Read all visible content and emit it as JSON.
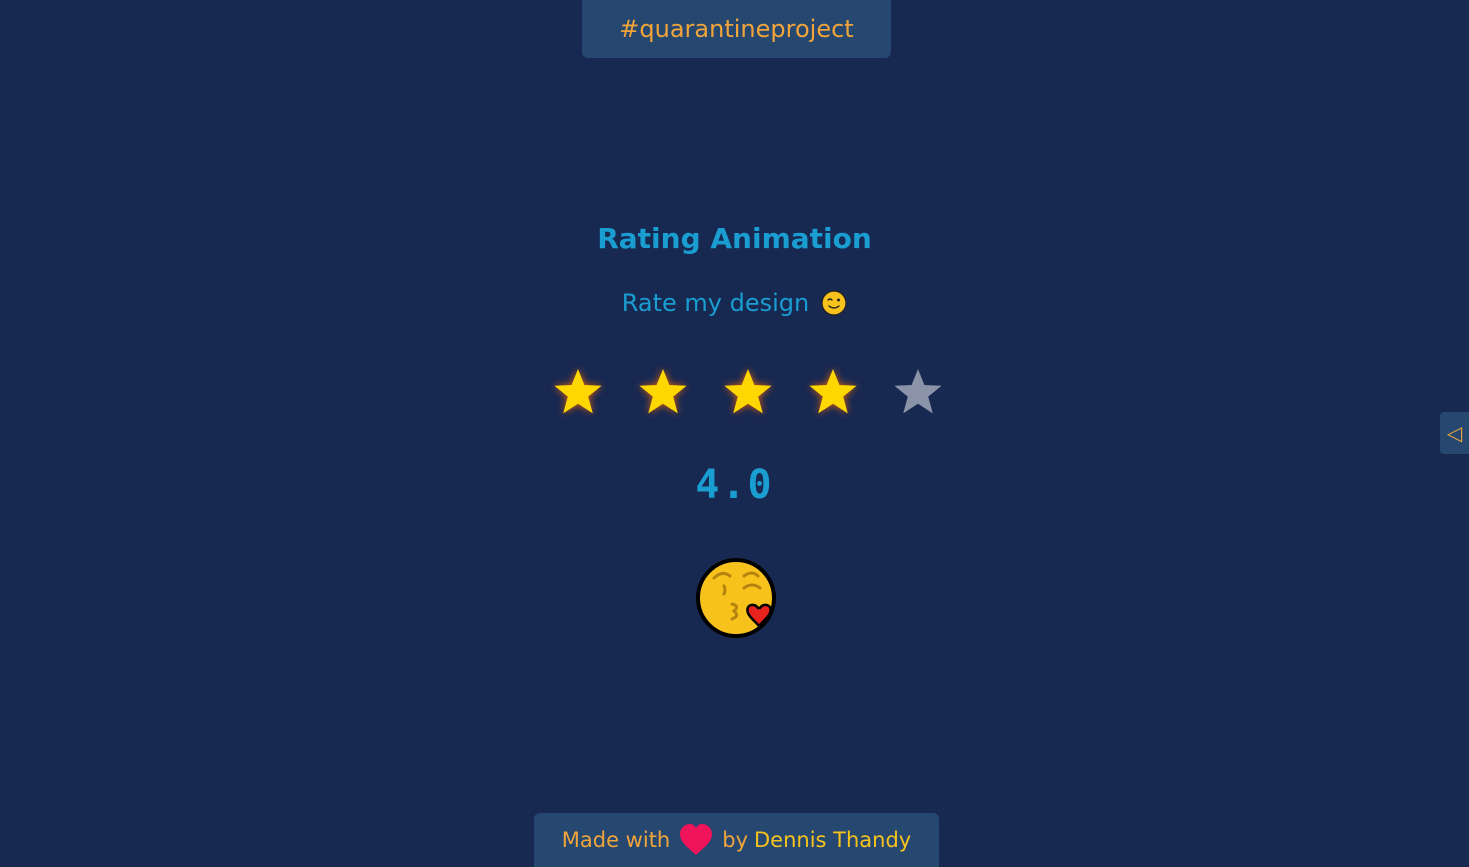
{
  "header": {
    "hashtag": "#quarantineproject"
  },
  "main": {
    "title": "Rating Animation",
    "subtitle": "Rate my design",
    "rating": {
      "value": 4,
      "max": 5,
      "display": "4.0"
    },
    "reaction_icon": "kissing-face-with-heart-icon"
  },
  "side_toggle": {
    "icon": "◁"
  },
  "footer": {
    "made_with": "Made with",
    "by": "by",
    "author": "Dennis Thandy"
  },
  "colors": {
    "background": "#172851",
    "panel": "#264870",
    "accent_blue": "#1a9dd1",
    "accent_orange": "#f0a43a",
    "star_filled": "#ffd700",
    "star_empty": "#8a93a8",
    "heart": "#f0145a"
  }
}
